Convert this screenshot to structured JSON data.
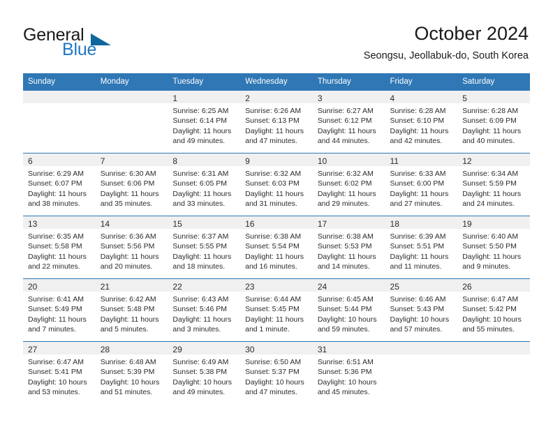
{
  "brand": {
    "name_part1": "General",
    "name_part2": "Blue"
  },
  "header": {
    "month_title": "October 2024",
    "location": "Seongsu, Jeollabuk-do, South Korea"
  },
  "colors": {
    "header_blue": "#2f77b5",
    "brand_blue": "#1f77c4",
    "logo_triangle": "#10659e",
    "daynum_band": "#f0f0f0"
  },
  "weekdays": [
    "Sunday",
    "Monday",
    "Tuesday",
    "Wednesday",
    "Thursday",
    "Friday",
    "Saturday"
  ],
  "weeks": [
    [
      {
        "day": "",
        "lines": []
      },
      {
        "day": "",
        "lines": []
      },
      {
        "day": "1",
        "lines": [
          "Sunrise: 6:25 AM",
          "Sunset: 6:14 PM",
          "Daylight: 11 hours",
          "and 49 minutes."
        ]
      },
      {
        "day": "2",
        "lines": [
          "Sunrise: 6:26 AM",
          "Sunset: 6:13 PM",
          "Daylight: 11 hours",
          "and 47 minutes."
        ]
      },
      {
        "day": "3",
        "lines": [
          "Sunrise: 6:27 AM",
          "Sunset: 6:12 PM",
          "Daylight: 11 hours",
          "and 44 minutes."
        ]
      },
      {
        "day": "4",
        "lines": [
          "Sunrise: 6:28 AM",
          "Sunset: 6:10 PM",
          "Daylight: 11 hours",
          "and 42 minutes."
        ]
      },
      {
        "day": "5",
        "lines": [
          "Sunrise: 6:28 AM",
          "Sunset: 6:09 PM",
          "Daylight: 11 hours",
          "and 40 minutes."
        ]
      }
    ],
    [
      {
        "day": "6",
        "lines": [
          "Sunrise: 6:29 AM",
          "Sunset: 6:07 PM",
          "Daylight: 11 hours",
          "and 38 minutes."
        ]
      },
      {
        "day": "7",
        "lines": [
          "Sunrise: 6:30 AM",
          "Sunset: 6:06 PM",
          "Daylight: 11 hours",
          "and 35 minutes."
        ]
      },
      {
        "day": "8",
        "lines": [
          "Sunrise: 6:31 AM",
          "Sunset: 6:05 PM",
          "Daylight: 11 hours",
          "and 33 minutes."
        ]
      },
      {
        "day": "9",
        "lines": [
          "Sunrise: 6:32 AM",
          "Sunset: 6:03 PM",
          "Daylight: 11 hours",
          "and 31 minutes."
        ]
      },
      {
        "day": "10",
        "lines": [
          "Sunrise: 6:32 AM",
          "Sunset: 6:02 PM",
          "Daylight: 11 hours",
          "and 29 minutes."
        ]
      },
      {
        "day": "11",
        "lines": [
          "Sunrise: 6:33 AM",
          "Sunset: 6:00 PM",
          "Daylight: 11 hours",
          "and 27 minutes."
        ]
      },
      {
        "day": "12",
        "lines": [
          "Sunrise: 6:34 AM",
          "Sunset: 5:59 PM",
          "Daylight: 11 hours",
          "and 24 minutes."
        ]
      }
    ],
    [
      {
        "day": "13",
        "lines": [
          "Sunrise: 6:35 AM",
          "Sunset: 5:58 PM",
          "Daylight: 11 hours",
          "and 22 minutes."
        ]
      },
      {
        "day": "14",
        "lines": [
          "Sunrise: 6:36 AM",
          "Sunset: 5:56 PM",
          "Daylight: 11 hours",
          "and 20 minutes."
        ]
      },
      {
        "day": "15",
        "lines": [
          "Sunrise: 6:37 AM",
          "Sunset: 5:55 PM",
          "Daylight: 11 hours",
          "and 18 minutes."
        ]
      },
      {
        "day": "16",
        "lines": [
          "Sunrise: 6:38 AM",
          "Sunset: 5:54 PM",
          "Daylight: 11 hours",
          "and 16 minutes."
        ]
      },
      {
        "day": "17",
        "lines": [
          "Sunrise: 6:38 AM",
          "Sunset: 5:53 PM",
          "Daylight: 11 hours",
          "and 14 minutes."
        ]
      },
      {
        "day": "18",
        "lines": [
          "Sunrise: 6:39 AM",
          "Sunset: 5:51 PM",
          "Daylight: 11 hours",
          "and 11 minutes."
        ]
      },
      {
        "day": "19",
        "lines": [
          "Sunrise: 6:40 AM",
          "Sunset: 5:50 PM",
          "Daylight: 11 hours",
          "and 9 minutes."
        ]
      }
    ],
    [
      {
        "day": "20",
        "lines": [
          "Sunrise: 6:41 AM",
          "Sunset: 5:49 PM",
          "Daylight: 11 hours",
          "and 7 minutes."
        ]
      },
      {
        "day": "21",
        "lines": [
          "Sunrise: 6:42 AM",
          "Sunset: 5:48 PM",
          "Daylight: 11 hours",
          "and 5 minutes."
        ]
      },
      {
        "day": "22",
        "lines": [
          "Sunrise: 6:43 AM",
          "Sunset: 5:46 PM",
          "Daylight: 11 hours",
          "and 3 minutes."
        ]
      },
      {
        "day": "23",
        "lines": [
          "Sunrise: 6:44 AM",
          "Sunset: 5:45 PM",
          "Daylight: 11 hours",
          "and 1 minute."
        ]
      },
      {
        "day": "24",
        "lines": [
          "Sunrise: 6:45 AM",
          "Sunset: 5:44 PM",
          "Daylight: 10 hours",
          "and 59 minutes."
        ]
      },
      {
        "day": "25",
        "lines": [
          "Sunrise: 6:46 AM",
          "Sunset: 5:43 PM",
          "Daylight: 10 hours",
          "and 57 minutes."
        ]
      },
      {
        "day": "26",
        "lines": [
          "Sunrise: 6:47 AM",
          "Sunset: 5:42 PM",
          "Daylight: 10 hours",
          "and 55 minutes."
        ]
      }
    ],
    [
      {
        "day": "27",
        "lines": [
          "Sunrise: 6:47 AM",
          "Sunset: 5:41 PM",
          "Daylight: 10 hours",
          "and 53 minutes."
        ]
      },
      {
        "day": "28",
        "lines": [
          "Sunrise: 6:48 AM",
          "Sunset: 5:39 PM",
          "Daylight: 10 hours",
          "and 51 minutes."
        ]
      },
      {
        "day": "29",
        "lines": [
          "Sunrise: 6:49 AM",
          "Sunset: 5:38 PM",
          "Daylight: 10 hours",
          "and 49 minutes."
        ]
      },
      {
        "day": "30",
        "lines": [
          "Sunrise: 6:50 AM",
          "Sunset: 5:37 PM",
          "Daylight: 10 hours",
          "and 47 minutes."
        ]
      },
      {
        "day": "31",
        "lines": [
          "Sunrise: 6:51 AM",
          "Sunset: 5:36 PM",
          "Daylight: 10 hours",
          "and 45 minutes."
        ]
      },
      {
        "day": "",
        "lines": []
      },
      {
        "day": "",
        "lines": []
      }
    ]
  ]
}
